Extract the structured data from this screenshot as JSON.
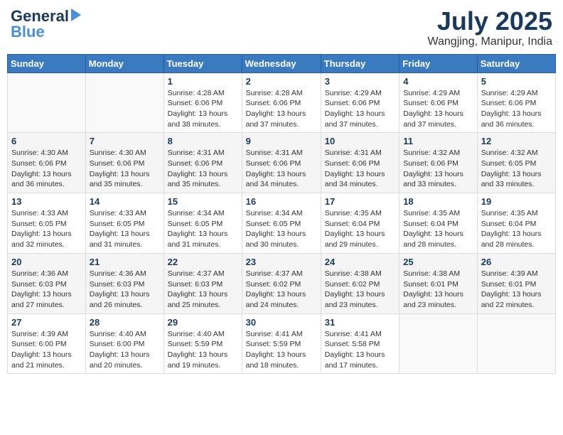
{
  "header": {
    "logo_general": "General",
    "logo_blue": "Blue",
    "month_title": "July 2025",
    "location": "Wangjing, Manipur, India"
  },
  "calendar": {
    "days_of_week": [
      "Sunday",
      "Monday",
      "Tuesday",
      "Wednesday",
      "Thursday",
      "Friday",
      "Saturday"
    ],
    "weeks": [
      [
        {
          "day": "",
          "info": ""
        },
        {
          "day": "",
          "info": ""
        },
        {
          "day": "1",
          "info": "Sunrise: 4:28 AM\nSunset: 6:06 PM\nDaylight: 13 hours\nand 38 minutes."
        },
        {
          "day": "2",
          "info": "Sunrise: 4:28 AM\nSunset: 6:06 PM\nDaylight: 13 hours\nand 37 minutes."
        },
        {
          "day": "3",
          "info": "Sunrise: 4:29 AM\nSunset: 6:06 PM\nDaylight: 13 hours\nand 37 minutes."
        },
        {
          "day": "4",
          "info": "Sunrise: 4:29 AM\nSunset: 6:06 PM\nDaylight: 13 hours\nand 37 minutes."
        },
        {
          "day": "5",
          "info": "Sunrise: 4:29 AM\nSunset: 6:06 PM\nDaylight: 13 hours\nand 36 minutes."
        }
      ],
      [
        {
          "day": "6",
          "info": "Sunrise: 4:30 AM\nSunset: 6:06 PM\nDaylight: 13 hours\nand 36 minutes."
        },
        {
          "day": "7",
          "info": "Sunrise: 4:30 AM\nSunset: 6:06 PM\nDaylight: 13 hours\nand 35 minutes."
        },
        {
          "day": "8",
          "info": "Sunrise: 4:31 AM\nSunset: 6:06 PM\nDaylight: 13 hours\nand 35 minutes."
        },
        {
          "day": "9",
          "info": "Sunrise: 4:31 AM\nSunset: 6:06 PM\nDaylight: 13 hours\nand 34 minutes."
        },
        {
          "day": "10",
          "info": "Sunrise: 4:31 AM\nSunset: 6:06 PM\nDaylight: 13 hours\nand 34 minutes."
        },
        {
          "day": "11",
          "info": "Sunrise: 4:32 AM\nSunset: 6:06 PM\nDaylight: 13 hours\nand 33 minutes."
        },
        {
          "day": "12",
          "info": "Sunrise: 4:32 AM\nSunset: 6:05 PM\nDaylight: 13 hours\nand 33 minutes."
        }
      ],
      [
        {
          "day": "13",
          "info": "Sunrise: 4:33 AM\nSunset: 6:05 PM\nDaylight: 13 hours\nand 32 minutes."
        },
        {
          "day": "14",
          "info": "Sunrise: 4:33 AM\nSunset: 6:05 PM\nDaylight: 13 hours\nand 31 minutes."
        },
        {
          "day": "15",
          "info": "Sunrise: 4:34 AM\nSunset: 6:05 PM\nDaylight: 13 hours\nand 31 minutes."
        },
        {
          "day": "16",
          "info": "Sunrise: 4:34 AM\nSunset: 6:05 PM\nDaylight: 13 hours\nand 30 minutes."
        },
        {
          "day": "17",
          "info": "Sunrise: 4:35 AM\nSunset: 6:04 PM\nDaylight: 13 hours\nand 29 minutes."
        },
        {
          "day": "18",
          "info": "Sunrise: 4:35 AM\nSunset: 6:04 PM\nDaylight: 13 hours\nand 28 minutes."
        },
        {
          "day": "19",
          "info": "Sunrise: 4:35 AM\nSunset: 6:04 PM\nDaylight: 13 hours\nand 28 minutes."
        }
      ],
      [
        {
          "day": "20",
          "info": "Sunrise: 4:36 AM\nSunset: 6:03 PM\nDaylight: 13 hours\nand 27 minutes."
        },
        {
          "day": "21",
          "info": "Sunrise: 4:36 AM\nSunset: 6:03 PM\nDaylight: 13 hours\nand 26 minutes."
        },
        {
          "day": "22",
          "info": "Sunrise: 4:37 AM\nSunset: 6:03 PM\nDaylight: 13 hours\nand 25 minutes."
        },
        {
          "day": "23",
          "info": "Sunrise: 4:37 AM\nSunset: 6:02 PM\nDaylight: 13 hours\nand 24 minutes."
        },
        {
          "day": "24",
          "info": "Sunrise: 4:38 AM\nSunset: 6:02 PM\nDaylight: 13 hours\nand 23 minutes."
        },
        {
          "day": "25",
          "info": "Sunrise: 4:38 AM\nSunset: 6:01 PM\nDaylight: 13 hours\nand 23 minutes."
        },
        {
          "day": "26",
          "info": "Sunrise: 4:39 AM\nSunset: 6:01 PM\nDaylight: 13 hours\nand 22 minutes."
        }
      ],
      [
        {
          "day": "27",
          "info": "Sunrise: 4:39 AM\nSunset: 6:00 PM\nDaylight: 13 hours\nand 21 minutes."
        },
        {
          "day": "28",
          "info": "Sunrise: 4:40 AM\nSunset: 6:00 PM\nDaylight: 13 hours\nand 20 minutes."
        },
        {
          "day": "29",
          "info": "Sunrise: 4:40 AM\nSunset: 5:59 PM\nDaylight: 13 hours\nand 19 minutes."
        },
        {
          "day": "30",
          "info": "Sunrise: 4:41 AM\nSunset: 5:59 PM\nDaylight: 13 hours\nand 18 minutes."
        },
        {
          "day": "31",
          "info": "Sunrise: 4:41 AM\nSunset: 5:58 PM\nDaylight: 13 hours\nand 17 minutes."
        },
        {
          "day": "",
          "info": ""
        },
        {
          "day": "",
          "info": ""
        }
      ]
    ]
  }
}
